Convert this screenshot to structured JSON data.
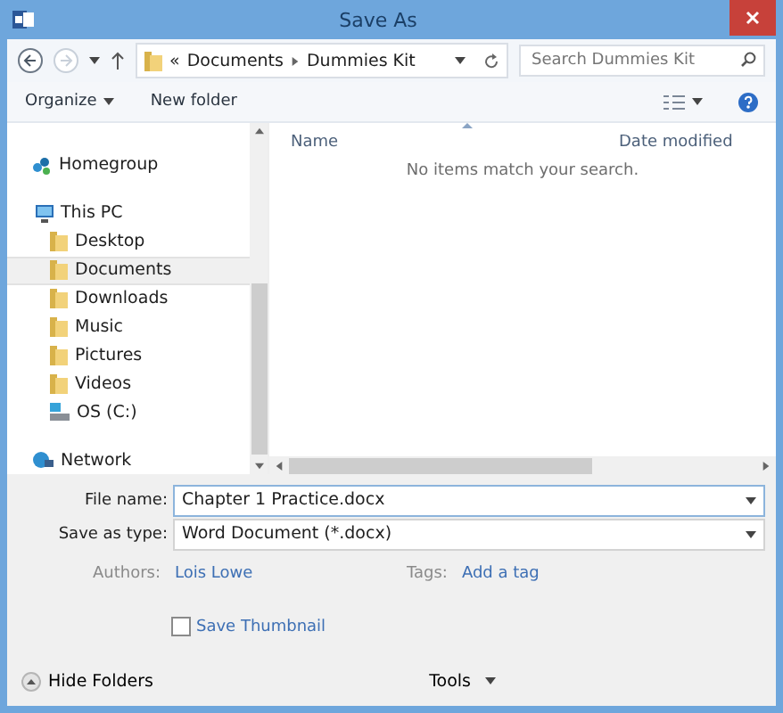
{
  "window": {
    "title": "Save As"
  },
  "address": {
    "overflow": "«",
    "path": [
      "Documents",
      "Dummies Kit"
    ]
  },
  "search": {
    "placeholder": "Search Dummies Kit"
  },
  "toolbar": {
    "organize": "Organize",
    "new_folder": "New folder"
  },
  "sidebar": {
    "items": [
      {
        "label": "Homegroup",
        "kind": "homegroup",
        "selected": false
      },
      {
        "label": "This PC",
        "kind": "pc",
        "selected": false,
        "children": [
          {
            "label": "Desktop",
            "kind": "folder",
            "selected": false
          },
          {
            "label": "Documents",
            "kind": "folder",
            "selected": true
          },
          {
            "label": "Downloads",
            "kind": "folder",
            "selected": false
          },
          {
            "label": "Music",
            "kind": "folder",
            "selected": false
          },
          {
            "label": "Pictures",
            "kind": "folder",
            "selected": false
          },
          {
            "label": "Videos",
            "kind": "folder",
            "selected": false
          },
          {
            "label": "OS (C:)",
            "kind": "drive",
            "selected": false
          }
        ]
      },
      {
        "label": "Network",
        "kind": "network",
        "selected": false
      }
    ]
  },
  "file_list": {
    "columns": [
      "Name",
      "Date modified"
    ],
    "empty_message": "No items match your search."
  },
  "form": {
    "file_name": {
      "label": "File name:",
      "value": "Chapter 1 Practice.docx"
    },
    "save_type": {
      "label": "Save as type:",
      "value": "Word Document (*.docx)"
    },
    "authors": {
      "label": "Authors:",
      "value": "Lois Lowe"
    },
    "tags": {
      "label": "Tags:",
      "value": "Add a tag"
    },
    "save_thumbnail": {
      "label": "Save Thumbnail",
      "checked": false
    }
  },
  "footer": {
    "hide_folders": "Hide Folders",
    "tools": "Tools"
  }
}
